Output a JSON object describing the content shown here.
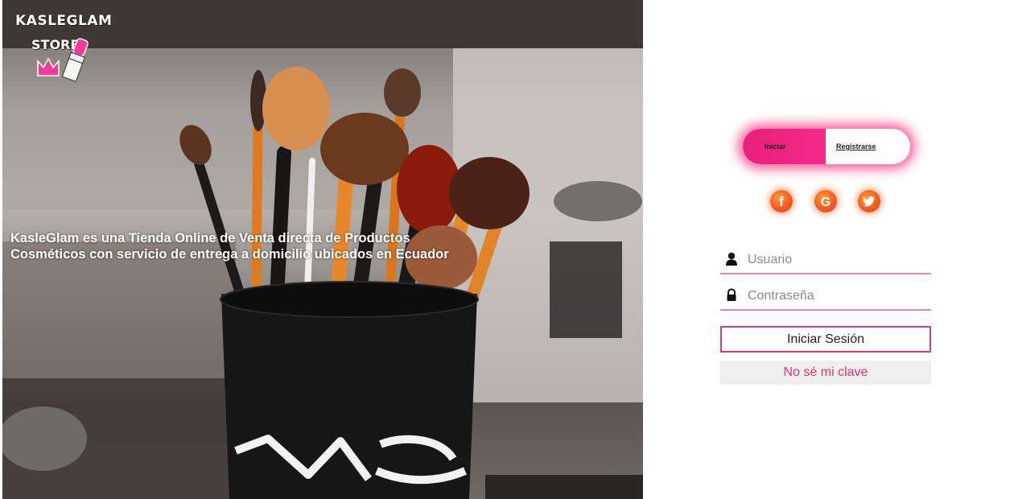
{
  "brand": {
    "logo_line1": "KASLEGLAM",
    "logo_line2": "STORE"
  },
  "hero": {
    "tagline_line1": "KasleGlam es una Tienda Online de Venta directa de Productos",
    "tagline_line2": "Cosméticos con servicio de entrega a domicilio ubicados en Ecuador",
    "cup_brand": "MAC"
  },
  "auth_toggle": {
    "login_label": "Iniciar",
    "register_label": "Registrarse",
    "active": "login"
  },
  "social": {
    "facebook_glyph": "f",
    "google_glyph": "G",
    "twitter_icon": "twitter-icon"
  },
  "form": {
    "username_placeholder": "Usuario",
    "password_placeholder": "Contraseña",
    "submit_label": "Iniciar Sesión",
    "forgot_label": "No sé mi clave"
  },
  "colors": {
    "accent": "#e8207a",
    "social_orange": "#f25c22",
    "field_underline": "#e888b4"
  }
}
